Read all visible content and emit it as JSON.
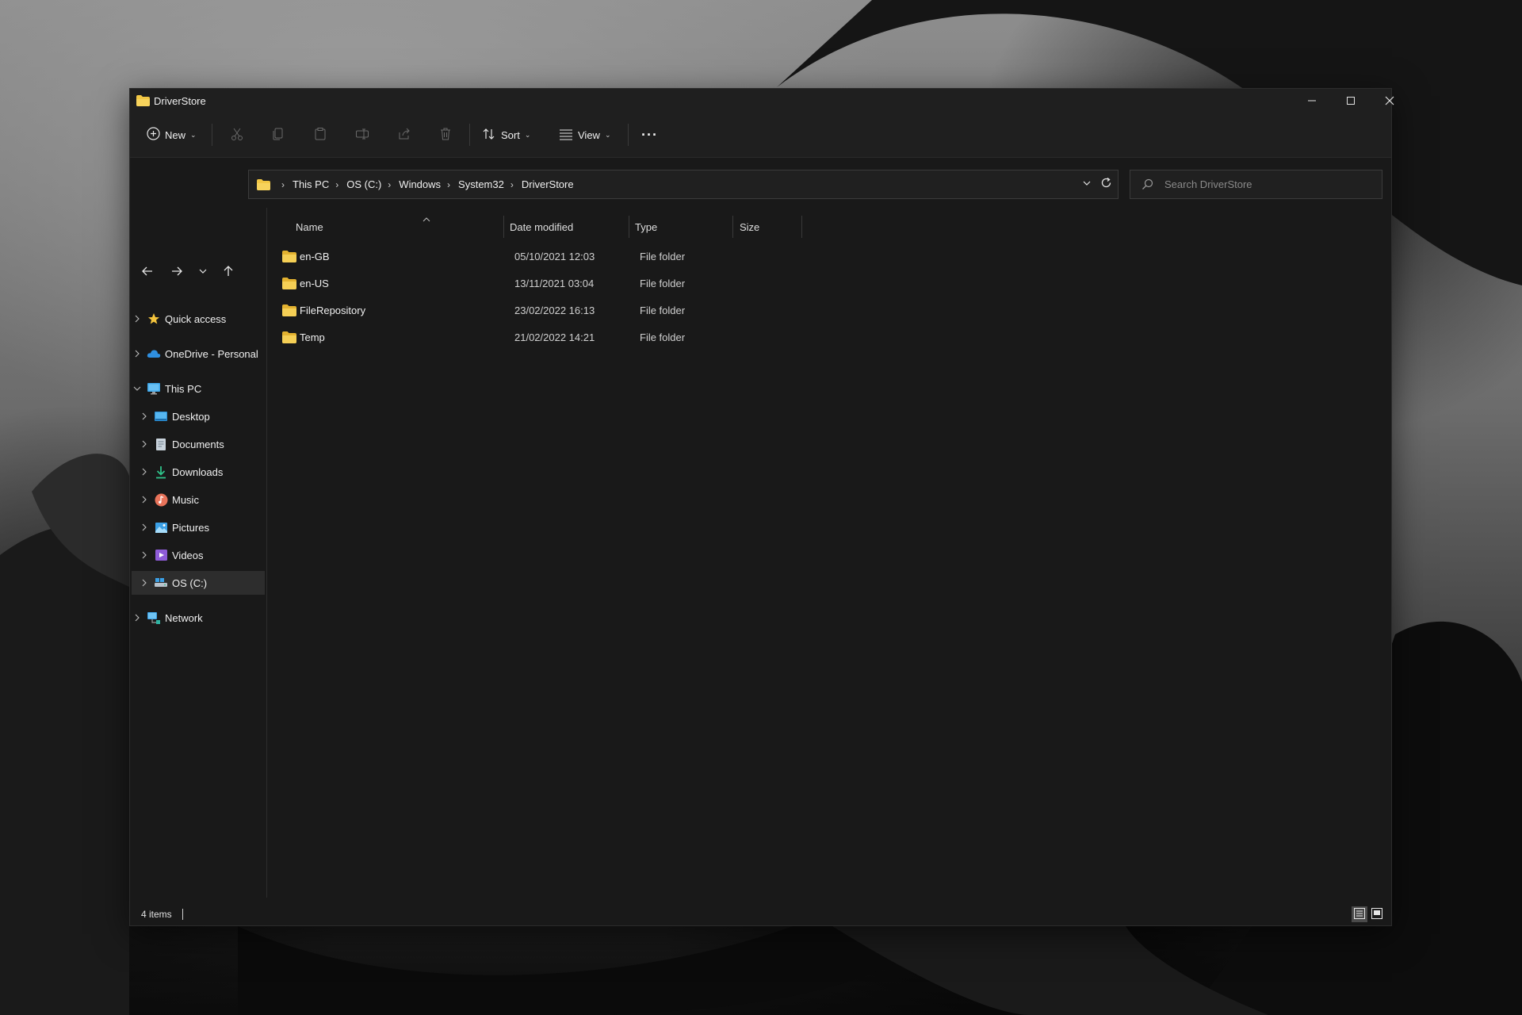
{
  "window": {
    "title": "DriverStore"
  },
  "toolbar": {
    "new_label": "New",
    "sort_label": "Sort",
    "view_label": "View",
    "more_label": "···"
  },
  "address": {
    "crumbs": [
      "This PC",
      "OS (C:)",
      "Windows",
      "System32",
      "DriverStore"
    ]
  },
  "search": {
    "placeholder": "Search DriverStore"
  },
  "sidebar": {
    "items": [
      {
        "label": "Quick access",
        "icon": "star-icon"
      },
      {
        "label": "OneDrive - Personal",
        "icon": "cloud-icon"
      },
      {
        "label": "This PC",
        "icon": "computer-icon"
      },
      {
        "label": "Desktop",
        "icon": "desktop-icon"
      },
      {
        "label": "Documents",
        "icon": "documents-icon"
      },
      {
        "label": "Downloads",
        "icon": "download-icon"
      },
      {
        "label": "Music",
        "icon": "music-icon"
      },
      {
        "label": "Pictures",
        "icon": "pictures-icon"
      },
      {
        "label": "Videos",
        "icon": "videos-icon"
      },
      {
        "label": "OS (C:)",
        "icon": "drive-icon"
      },
      {
        "label": "Network",
        "icon": "network-icon"
      }
    ]
  },
  "columns": {
    "name": "Name",
    "date": "Date modified",
    "type": "Type",
    "size": "Size"
  },
  "files": [
    {
      "name": "en-GB",
      "date": "05/10/2021 12:03",
      "type": "File folder",
      "size": ""
    },
    {
      "name": "en-US",
      "date": "13/11/2021 03:04",
      "type": "File folder",
      "size": ""
    },
    {
      "name": "FileRepository",
      "date": "23/02/2022 16:13",
      "type": "File folder",
      "size": ""
    },
    {
      "name": "Temp",
      "date": "21/02/2022 14:21",
      "type": "File folder",
      "size": ""
    }
  ],
  "status": {
    "item_count": "4 items"
  },
  "colors": {
    "folder": "#f2c744",
    "window_bg": "#191919",
    "selected": "#2d2d2d",
    "accent": "#4aa3f0"
  }
}
